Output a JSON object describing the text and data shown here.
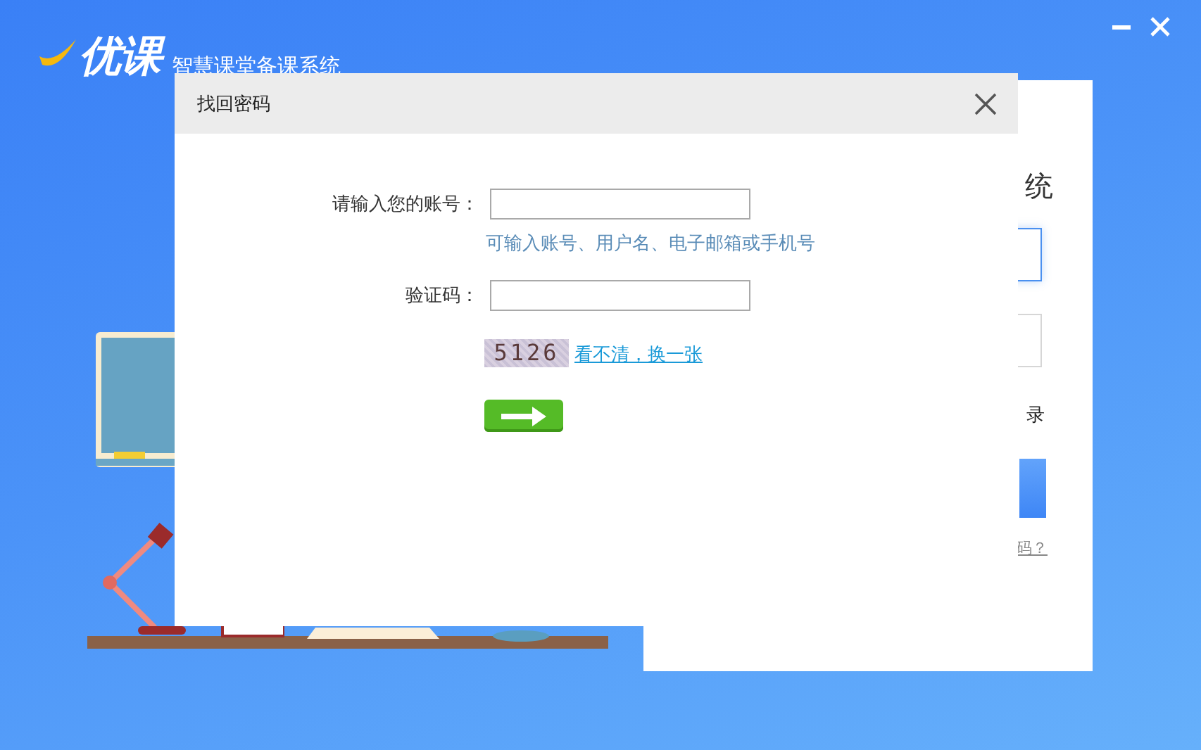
{
  "app": {
    "logo": "优课",
    "subtitle": "智慧课堂备课系统"
  },
  "login_card": {
    "title_fragment": "统",
    "remember_fragment": "录",
    "link_fragment": "码？"
  },
  "dialog": {
    "title": "找回密码",
    "account": {
      "label": "请输入您的账号：",
      "hint": "可输入账号、用户名、电子邮箱或手机号"
    },
    "captcha": {
      "label": "验证码：",
      "code": "5126",
      "refresh_link": "看不清，换一张"
    }
  }
}
